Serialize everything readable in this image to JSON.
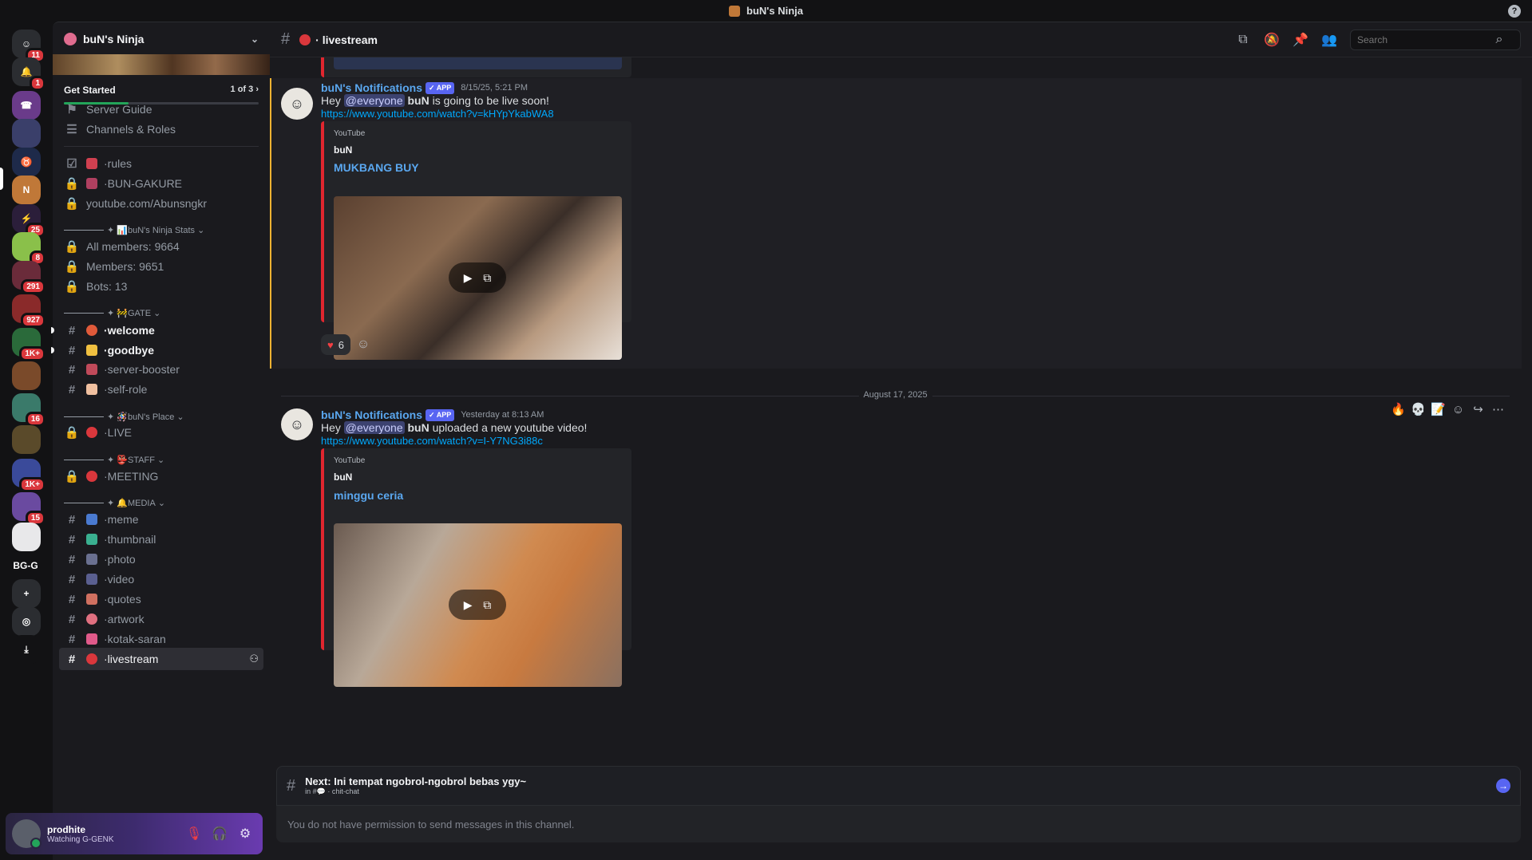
{
  "window": {
    "title": "buN's Ninja",
    "help": "?"
  },
  "rail": {
    "servers": [
      {
        "name": "dms",
        "badge": "11",
        "color": "#2b2d31",
        "glyph": "☺"
      },
      {
        "name": "notifications",
        "badge": "1",
        "color": "#2b2d31",
        "glyph": "🔔"
      },
      {
        "name": "server-1",
        "badge": "",
        "color": "#6a3b8a",
        "glyph": "☎"
      },
      {
        "name": "server-2",
        "badge": "",
        "color": "#3a3f6a",
        "glyph": ""
      },
      {
        "name": "server-3",
        "badge": "",
        "color": "#1e2a4a",
        "glyph": "♉"
      },
      {
        "name": "server-buns-ninja",
        "badge": "",
        "color": "#c07838",
        "glyph": "N"
      },
      {
        "name": "server-5",
        "badge": "25",
        "color": "#2b1e3a",
        "glyph": "⚡"
      },
      {
        "name": "server-6",
        "badge": "8",
        "color": "#8ac04a",
        "glyph": ""
      },
      {
        "name": "server-7",
        "badge": "291",
        "color": "#6a2b3a",
        "glyph": ""
      },
      {
        "name": "server-8",
        "badge": "927",
        "color": "#8a2a2a",
        "glyph": ""
      },
      {
        "name": "server-9",
        "badge": "1K+",
        "color": "#2a6a3a",
        "glyph": ""
      },
      {
        "name": "server-10",
        "badge": "",
        "color": "#7a4a2a",
        "glyph": ""
      },
      {
        "name": "server-11",
        "badge": "16",
        "color": "#3a7a6a",
        "glyph": ""
      },
      {
        "name": "server-12",
        "badge": "",
        "color": "#5a4a2a",
        "glyph": ""
      },
      {
        "name": "server-13",
        "badge": "1K+",
        "color": "#3a4a9a",
        "glyph": ""
      },
      {
        "name": "server-14",
        "badge": "15",
        "color": "#6a4aa0",
        "glyph": ""
      },
      {
        "name": "server-15",
        "badge": "",
        "color": "#e8e8ea",
        "glyph": ""
      },
      {
        "name": "server-bgg",
        "badge": "",
        "color": "#121214",
        "glyph": "BG-G"
      },
      {
        "name": "add-server",
        "badge": "",
        "color": "#2b2d31",
        "glyph": "+"
      },
      {
        "name": "discover",
        "badge": "",
        "color": "#2b2d31",
        "glyph": "◎"
      },
      {
        "name": "download",
        "badge": "",
        "color": "#121214",
        "glyph": "⤓"
      }
    ]
  },
  "server": {
    "name": "buN's Ninja",
    "get_started": {
      "label": "Get Started",
      "progress": "1 of 3",
      "fraction": 0.33
    },
    "guide": "Server Guide",
    "channels_roles": "Channels & Roles"
  },
  "channels": {
    "rules": "rules",
    "bungakure": "BUN-GAKURE",
    "youtube": "youtube.com/Abunsngkr",
    "cat_stats": "buN's Ninja Stats",
    "all_members": "All members: 9664",
    "members": "Members: 9651",
    "bots": "Bots: 13",
    "cat_gate": "GATE",
    "welcome": "welcome",
    "goodbye": "goodbye",
    "server_booster": "server-booster",
    "self_role": "self-role",
    "cat_place": "buN's Place",
    "live": "LIVE",
    "cat_staff": "STAFF",
    "meeting": "MEETING",
    "cat_media": "MEDIA",
    "meme": "meme",
    "thumbnail": "thumbnail",
    "photo": "photo",
    "video": "video",
    "quotes": "quotes",
    "artwork": "artwork",
    "kotak_saran": "kotak-saran",
    "livestream": "livestream"
  },
  "user": {
    "name": "prodhite",
    "status": "Watching G-GENK"
  },
  "header": {
    "channel": "livestream",
    "search_placeholder": "Search"
  },
  "messages": [
    {
      "author": "buN's Notifications",
      "tag": "✓ APP",
      "time": "8/15/25, 5:21 PM",
      "text_pre": "Hey ",
      "mention": "@everyone",
      "bold": "buN",
      "text_post": " is going to be live soon!",
      "link": "https://www.youtube.com/watch?v=kHYpYkabWA8",
      "embed": {
        "provider": "YouTube",
        "author": "buN",
        "title": "MUKBANG BUY"
      },
      "reaction_count": "6"
    },
    {
      "author": "buN's Notifications",
      "tag": "✓ APP",
      "time": "Yesterday at 8:13 AM",
      "text_pre": "Hey ",
      "mention": "@everyone",
      "bold": "buN",
      "text_post": " uploaded a new youtube video!",
      "link": "https://www.youtube.com/watch?v=I-Y7NG3i88c",
      "embed": {
        "provider": "YouTube",
        "author": "buN",
        "title": "minggu ceria"
      }
    }
  ],
  "date_divider": "August 17, 2025",
  "next": {
    "title": "Next: Ini tempat ngobrol-ngobrol bebas ygy~",
    "sub_prefix": "in #",
    "sub_channel": "chit-chat"
  },
  "no_permission": "You do not have permission to send messages in this channel."
}
